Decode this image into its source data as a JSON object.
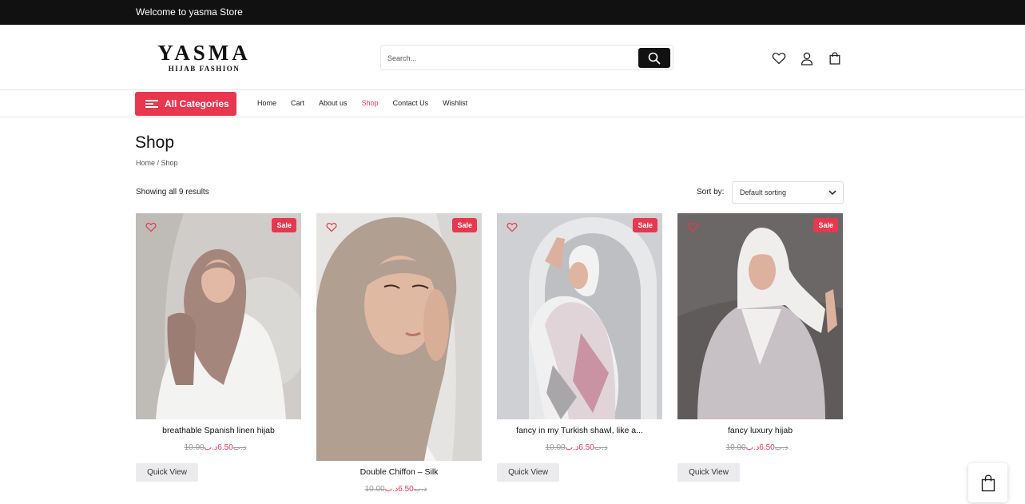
{
  "topbar": {
    "welcome": "Welcome to yasma Store"
  },
  "header": {
    "logo_main": "YASMA",
    "logo_sub": "HIJAB FASHION",
    "search_placeholder": "Search...",
    "icons": [
      "search-icon",
      "heart-icon",
      "user-icon",
      "bag-icon"
    ]
  },
  "nav": {
    "all_categories": "All Categories",
    "links": [
      "Home",
      "Cart",
      "About us",
      "Shop",
      "Contact Us",
      "Wishlist"
    ],
    "active": "Shop"
  },
  "page": {
    "title": "Shop",
    "breadcrumb": [
      "Home",
      "Shop"
    ],
    "breadcrumb_sep": " / ",
    "results": "Showing all 9 results",
    "sort_label": "Sort by:",
    "sort_value": "Default sorting"
  },
  "products": [
    {
      "name": "breathable Spanish linen hijab",
      "old_price": "10.00د.ب",
      "new_price": "6.50د.ب",
      "badge": "Sale",
      "quick_view": "Quick View"
    },
    {
      "name": "Double Chiffon – Silk",
      "old_price": "10.00د.ب",
      "new_price": "6.50د.ب",
      "badge": "Sale",
      "quick_view": "Quick View"
    },
    {
      "name": "fancy in my Turkish shawl, like a...",
      "old_price": "10.00د.ب",
      "new_price": "6.50د.ب",
      "badge": "Sale",
      "quick_view": "Quick View"
    },
    {
      "name": "fancy luxury hijab",
      "old_price": "10.00د.ب",
      "new_price": "6.50د.ب",
      "badge": "Sale",
      "quick_view": "Quick View"
    }
  ],
  "colors": {
    "accent": "#e8374f",
    "topbar": "#111111",
    "quick_view_bg": "#ebebed"
  }
}
